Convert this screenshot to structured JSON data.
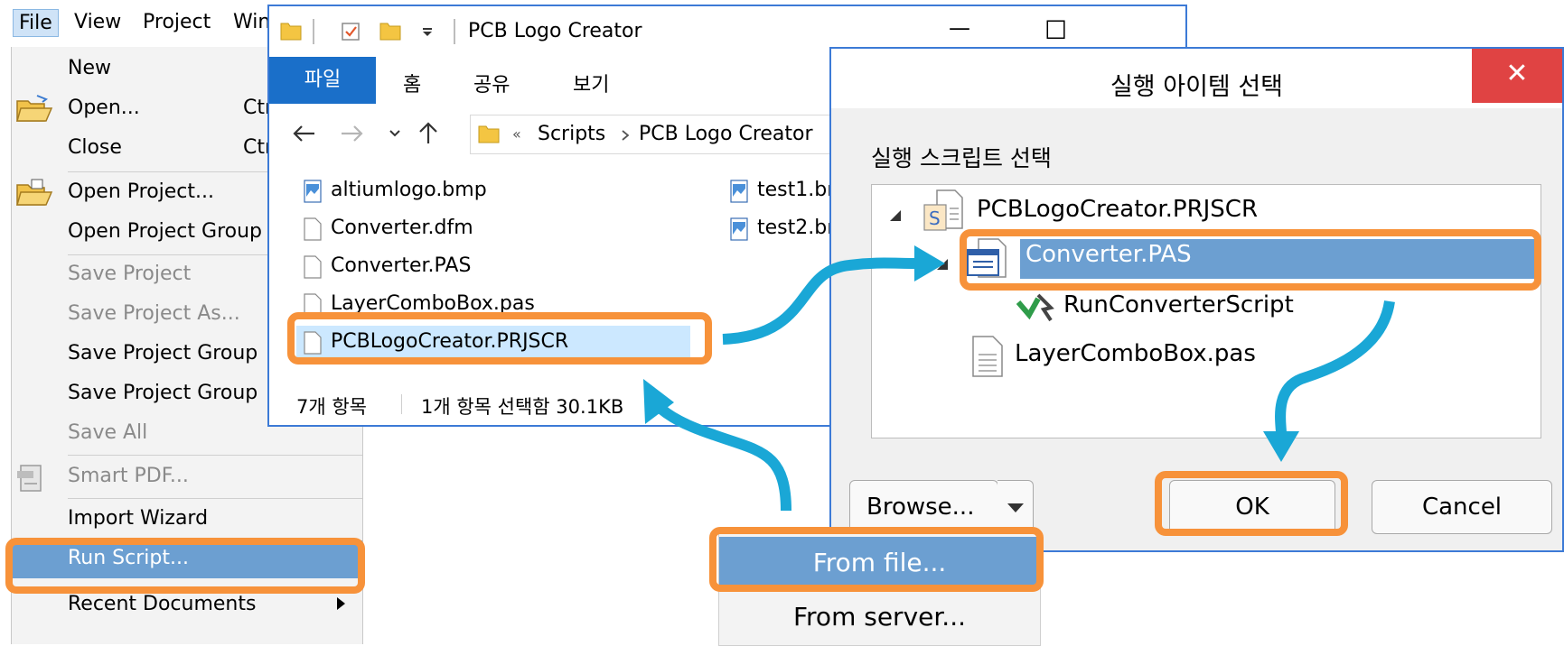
{
  "menubar": {
    "items": [
      "File",
      "View",
      "Project",
      "Win"
    ]
  },
  "file_menu": {
    "items": [
      {
        "label": "New"
      },
      {
        "label": "Open...",
        "shortcut": "Ctr"
      },
      {
        "label": "Close",
        "shortcut": "Ctr"
      },
      {
        "label": "Open Project..."
      },
      {
        "label": "Open Project Group"
      },
      {
        "label": "Save Project"
      },
      {
        "label": "Save Project As..."
      },
      {
        "label": "Save Project Group"
      },
      {
        "label": "Save Project Group"
      },
      {
        "label": "Save All"
      },
      {
        "label": "Smart PDF..."
      },
      {
        "label": "Import Wizard"
      },
      {
        "label": "Run Script..."
      },
      {
        "label": "Recent Documents"
      }
    ]
  },
  "explorer": {
    "title": "PCB Logo Creator",
    "ribbon_tabs": [
      "파일",
      "홈",
      "공유",
      "보기"
    ],
    "breadcrumb": [
      "Scripts",
      "PCB Logo Creator"
    ],
    "breadcrumb_overflow": "«",
    "files_left": [
      "altiumlogo.bmp",
      "Converter.dfm",
      "Converter.PAS",
      "LayerComboBox.pas",
      "PCBLogoCreator.PRJSCR"
    ],
    "files_right": [
      "test1.br",
      "test2.br"
    ],
    "status_items": "7개 항목",
    "status_selected": "1개 항목 선택함 30.1KB",
    "window_buttons": {
      "minimize": "—",
      "maximize": "☐",
      "close": "✕"
    }
  },
  "dialog": {
    "title": "실행 아이템 선택",
    "close_label": "✕",
    "subtitle": "실행 스크립트 선택",
    "tree": {
      "project": "PCBLogoCreator.PRJSCR",
      "file_selected": "Converter.PAS",
      "procedure": "RunConverterScript",
      "file_other": "LayerComboBox.pas"
    },
    "browse_label": "Browse...",
    "ok_label": "OK",
    "cancel_label": "Cancel"
  },
  "browse_menu": {
    "items": [
      "From file...",
      "From server..."
    ]
  },
  "colors": {
    "highlight": "#f7923a",
    "arrow": "#1aa7d6",
    "selection": "#6c9fd1",
    "ribbon_file": "#1a6fc9",
    "close_red": "#e04343"
  }
}
